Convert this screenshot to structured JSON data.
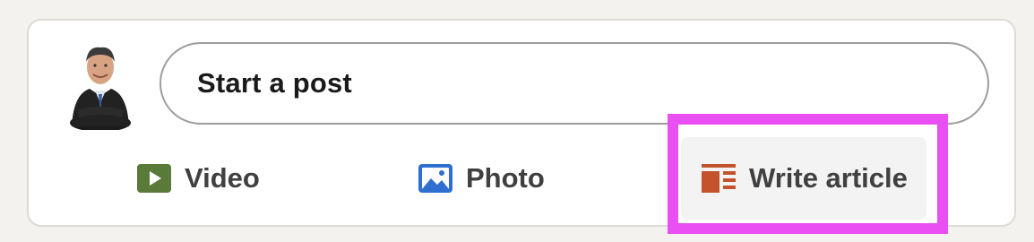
{
  "composer": {
    "placeholder": "Start a post"
  },
  "actions": {
    "video": {
      "label": "Video",
      "icon": "video-icon",
      "color": "#5a7a3a"
    },
    "photo": {
      "label": "Photo",
      "icon": "photo-icon",
      "color": "#2f6fd0"
    },
    "article": {
      "label": "Write article",
      "icon": "article-icon",
      "color": "#c3532d"
    }
  },
  "highlight": {
    "color": "#ea4ff3",
    "target": "write-article-button"
  }
}
